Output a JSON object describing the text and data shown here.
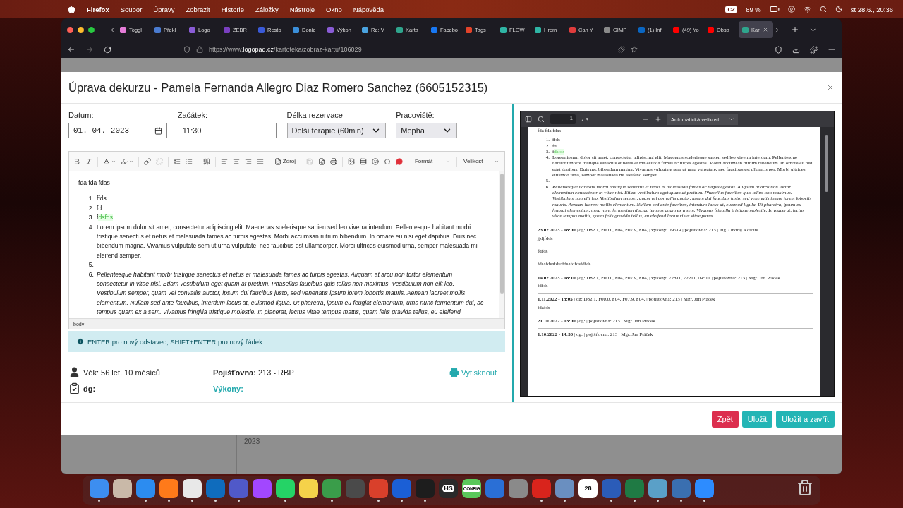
{
  "menubar": {
    "app": "Firefox",
    "items": [
      "Soubor",
      "Úpravy",
      "Zobrazit",
      "Historie",
      "Záložky",
      "Nástroje",
      "Okno",
      "Nápověda"
    ],
    "keyboard": "CZ",
    "battery": "89 %",
    "clock": "st 28.6., 20:36"
  },
  "tabs": [
    {
      "title": "Toggl",
      "color": "#e57cd8",
      "selected": false
    },
    {
      "title": "Překl",
      "color": "#4a7bd0",
      "selected": false
    },
    {
      "title": "Logo",
      "color": "#8a5cd6",
      "selected": false
    },
    {
      "title": "ZEBR",
      "color": "#7a3fc0",
      "selected": false
    },
    {
      "title": "Resto",
      "color": "#3a5ad8",
      "selected": false
    },
    {
      "title": "Donic",
      "color": "#3b8fd9",
      "selected": false
    },
    {
      "title": "Výkon",
      "color": "#8a5cd6",
      "selected": false
    },
    {
      "title": "Re: V",
      "color": "#4aa3df",
      "selected": false
    },
    {
      "title": "Karta",
      "color": "#2fa58d",
      "selected": false
    },
    {
      "title": "Facebo",
      "color": "#1877f2",
      "selected": false
    },
    {
      "title": "Tags",
      "color": "#e2432a",
      "selected": false
    },
    {
      "title": "FLOW",
      "color": "#2fb5a5",
      "selected": false
    },
    {
      "title": "Hrom",
      "color": "#2fb5a5",
      "selected": false
    },
    {
      "title": "Can Y",
      "color": "#e03c3c",
      "selected": false
    },
    {
      "title": "GIMP",
      "color": "#8a8a8a",
      "selected": false
    },
    {
      "title": "(1) Inf",
      "color": "#0a66c2",
      "selected": false
    },
    {
      "title": "(49) Yo",
      "color": "#ff0000",
      "selected": false
    },
    {
      "title": "Obsa",
      "color": "#ff0000",
      "selected": false
    },
    {
      "title": "Kar",
      "color": "#2fa58d",
      "selected": true
    }
  ],
  "url": {
    "prefix": "https://www.",
    "domain": "logopad.cz",
    "path": "/kartoteka/zobraz-kartu/106029"
  },
  "background": {
    "year": "2023"
  },
  "modal": {
    "title": "Úprava dekurzu - Pamela Fernanda Allegro Diaz Romero Sanchez (6605152315)",
    "fields": [
      {
        "label": "Datum:",
        "kind": "date",
        "value": "01. 04. 2023"
      },
      {
        "label": "Začátek:",
        "kind": "text",
        "value": "11:30"
      },
      {
        "label": "Délka rezervace",
        "kind": "select",
        "value": "Delší terapie (60min)"
      },
      {
        "label": "Pracoviště:",
        "kind": "select",
        "value": "Mepha"
      }
    ],
    "editor": {
      "source": "Zdroj",
      "format": "Formát",
      "size": "Velikost",
      "intro": "fda fda fdas",
      "path": "body",
      "list": [
        {
          "kind": "text",
          "marker": "1.",
          "text": "ffds",
          "italic": false
        },
        {
          "kind": "text",
          "marker": "2.",
          "text": "fd",
          "italic": false
        },
        {
          "kind": "text",
          "marker": "3.",
          "text": "f",
          "highlight": "dsfds",
          "italic": false
        },
        {
          "kind": "text",
          "marker": "4.",
          "text": "Lorem ipsum dolor sit amet, consectetur adipiscing elit. Maecenas scelerisque sapien sed leo viverra interdum. Pellentesque habitant morbi tristique senectus et netus et malesuada fames ac turpis egestas. Morbi accumsan rutrum bibendum. In ornare eu nisi eget dapibus. Duis nec bibendum magna. Vivamus vulputate sem ut urna vulputate, nec faucibus est ullamcorper. Morbi ultrices euismod urna, semper malesuada mi eleifend semper.",
          "italic": false
        },
        {
          "kind": "blank",
          "marker": "5."
        },
        {
          "kind": "text",
          "marker": "6.",
          "text": "Pellentesque habitant morbi tristique senectus et netus et malesuada fames ac turpis egestas. Aliquam at arcu non tortor elementum consectetur in vitae nisi. Etiam vestibulum eget quam at pretium. Phasellus faucibus quis tellus non maximus. Vestibulum non elit leo. Vestibulum semper, quam vel convallis auctor, ipsum dui faucibus justo, sed venenatis ipsum lorem lobortis mauris. Aenean laoreet mollis elementum. Nullam sed ante faucibus, interdum lacus at, euismod ligula. Ut pharetra, ipsum eu feugiat elementum, urna nunc fermentum dui, ac tempus quam ex a sem. Vivamus fringilla tristique molestie. In placerat, lectus vitae tempus mattis, quam felis gravida tellus, eu eleifend",
          "italic": true
        }
      ]
    },
    "hint": "ENTER pro nový odstavec, SHIFT+ENTER pro nový řádek",
    "info": {
      "age": "Věk: 56 let, 10 měsíců",
      "insurance_label": "Pojišťovna:",
      "insurance": "213 - RBP",
      "print": "Vytisknout",
      "dg": "dg:",
      "procedures": "Výkony:"
    },
    "pdf": {
      "page": "1",
      "pages": "z 3",
      "zoom": "Automatická velikost",
      "intro": "fda fda fdas",
      "list": [
        {
          "kind": "text",
          "marker": "1.",
          "text": "ffds",
          "italic": false
        },
        {
          "kind": "text",
          "marker": "2.",
          "text": "fd",
          "italic": false
        },
        {
          "kind": "text",
          "marker": "3.",
          "text": "f",
          "highlight": "dsfds",
          "italic": false
        },
        {
          "kind": "text",
          "marker": "4.",
          "text": "Lorem ipsum dolor sit amet, consectetur adipiscing elit. Maecenas scelerisque sapien sed leo viverra interdum. Pellentesque habitant morbi tristique senectus et netus et malesuada fames ac turpis egestas. Morbi accumsan rutrum bibendum. In ornare eu nisi eget dapibus. Duis nec bibendum magna. Vivamus vulputate sem ut urna vulputate, nec faucibus est ullamcorper. Morbi ultrices euismod urna, semper malesuada mi eleifend semper.",
          "italic": false
        },
        {
          "kind": "blank",
          "marker": "5."
        },
        {
          "kind": "text",
          "marker": "6.",
          "text": "Pellentesque habitant morbi tristique senectus et netus et malesuada fames ac turpis egestas. Aliquam at arcu non tortor elementum consectetur in vitae nisi. Etiam vestibulum eget quam at pretium. Phasellus faucibus quis tellus non maximus. Vestibulum non elit leo. Vestibulum semper, quam vel convallis auctor, ipsum dui faucibus justo, sed venenatis ipsum lorem lobortis mauris. Aenean laoreet mollis elementum. Nullam sed ante faucibus, interdum lacus at, euismod ligula. Ut pharetra, ipsum eu feugiat elementum, urna nunc fermentum dui, ac tempus quam ex a sem. Vivamus fringilla tristique molestie. In placerat, lectus vitae tempus mattis, quam felis gravida tellus, eu eleifend lectus risus vitae purus.",
          "italic": true
        }
      ],
      "entries": [
        {
          "header": "**23.02.2023 - 08:00** | dg: D82.1, F00.0, F04, F07.9, F04, | výkony: 09519 | pojišťovna: 213 | Ing. Ondřej Korouš",
          "notes": [
            "jjdjfdds",
            "fdfds",
            "fdsafdsafdsafdsafdfdsfdfds"
          ]
        },
        {
          "header": "**14.02.2023 - 18:10** | dg: D82.1, F00.0, F04, F07.9, F04, | výkony: 72311, 72211, 09511 | pojišťovna: 213 | Mgr. Jan Ptáček",
          "notes": [
            "fdfds"
          ]
        },
        {
          "header": "**1.11.2022 - 13:05** | dg: D82.1, F00.0, F04, F07.9, F04, | pojišťovna: 213 | Mgr. Jan Ptáček",
          "notes": [
            "fdafds"
          ]
        },
        {
          "header": "**21.10.2022 - 13:00** | dg: | pojišťovna: 213 | Mgr. Jan Ptáček"
        },
        {
          "header": "**1.10.2022 - 14:50** | dg: | pojišťovna: 213 | Mgr. Jan Ptáček"
        }
      ]
    },
    "buttons": [
      {
        "label": "Zpět",
        "kind": "danger"
      },
      {
        "label": "Uložit",
        "kind": "primary"
      },
      {
        "label": "Uložit a zavřít",
        "kind": "primary"
      }
    ]
  },
  "dock": [
    {
      "color": "#3d8ef0",
      "running": true
    },
    {
      "color": "#c9b9a8",
      "running": false
    },
    {
      "color": "#2c8cf0",
      "running": true
    },
    {
      "color": "#ff7a1a",
      "running": true
    },
    {
      "color": "#e8e8e8",
      "running": true
    },
    {
      "color": "#0f6cbd",
      "running": true
    },
    {
      "color": "#5059c9",
      "running": true
    },
    {
      "color": "#a247ff",
      "running": false
    },
    {
      "color": "#25d366",
      "running": true
    },
    {
      "color": "#f5d24a",
      "running": false
    },
    {
      "color": "#3a9d4a",
      "running": true
    },
    {
      "color": "#4a4a4a",
      "running": false
    },
    {
      "color": "#d9402b",
      "running": true
    },
    {
      "color": "#1b5fd6",
      "running": true
    },
    {
      "color": "#1d1d1d",
      "running": true
    },
    {
      "color": "#2a2a2a",
      "label": "HS",
      "running": false
    },
    {
      "color": "#5ac85a",
      "label": "CONFIG",
      "running": false
    },
    {
      "color": "#2a6fd6",
      "running": false
    },
    {
      "color": "#8a8a8a",
      "running": false
    },
    {
      "color": "#d9241c",
      "running": true
    },
    {
      "color": "#6a8fc0",
      "running": true
    },
    {
      "color": "#ffffff",
      "label": "28",
      "running": false
    },
    {
      "color": "#2b5cb8",
      "running": true
    },
    {
      "color": "#1f7a44",
      "running": true
    },
    {
      "color": "#5aa0c8",
      "running": true
    },
    {
      "color": "#3a6fb0",
      "running": true
    },
    {
      "color": "#2d8cff",
      "running": true
    }
  ]
}
